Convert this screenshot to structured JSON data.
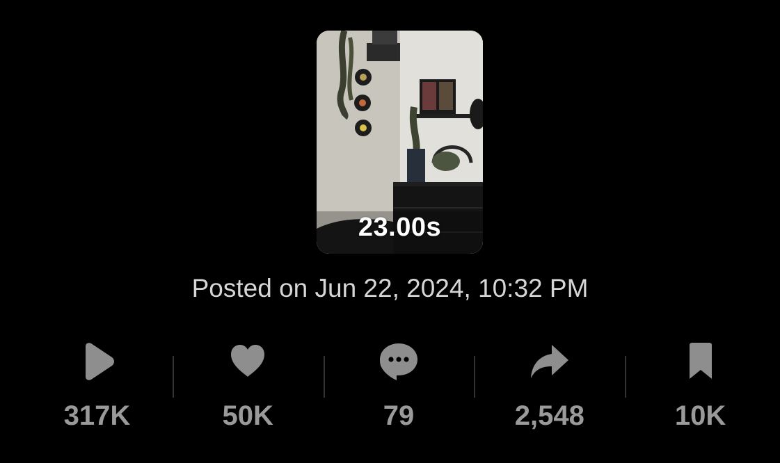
{
  "video": {
    "duration": "23.00s",
    "posted": "Posted on Jun 22, 2024, 10:32 PM"
  },
  "stats": {
    "views": "317K",
    "likes": "50K",
    "comments": "79",
    "shares": "2,548",
    "saves": "10K"
  },
  "colors": {
    "background": "#000000",
    "icon": "#8e8e8e",
    "count": "#9a9a9a",
    "posted_text": "#d6d6d6"
  }
}
